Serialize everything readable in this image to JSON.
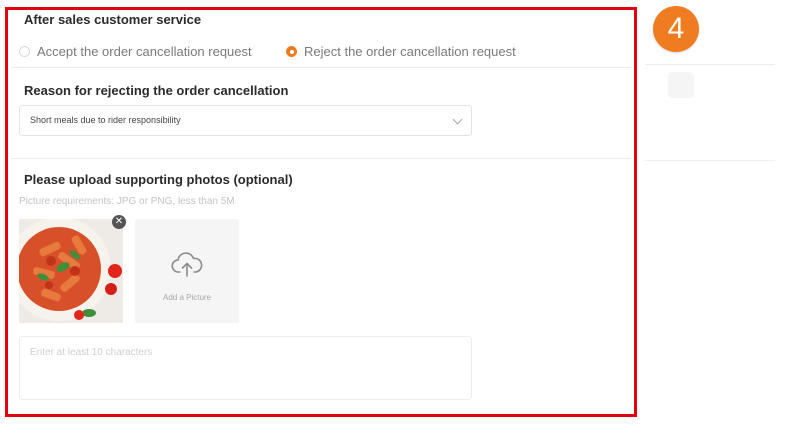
{
  "step_badge": "4",
  "sections": {
    "after_sales_title": "After sales customer service",
    "reason_title": "Reason for rejecting the order cancellation",
    "upload_title": "Please upload supporting photos (optional)"
  },
  "radio_options": {
    "accept_label": "Accept the order cancellation request",
    "reject_label": "Reject the order cancellation request",
    "selected": "reject"
  },
  "reason_select": {
    "selected_value": "Short meals due to rider responsibility"
  },
  "upload": {
    "requirements_hint": "Picture requirements: JPG or PNG, less than 5M",
    "add_picture_label": "Add a Picture",
    "remove_glyph": "✕"
  },
  "comment": {
    "placeholder": "Enter at least 10 characters"
  },
  "colors": {
    "accent": "#f07c22",
    "highlight_border": "#e3000f"
  }
}
